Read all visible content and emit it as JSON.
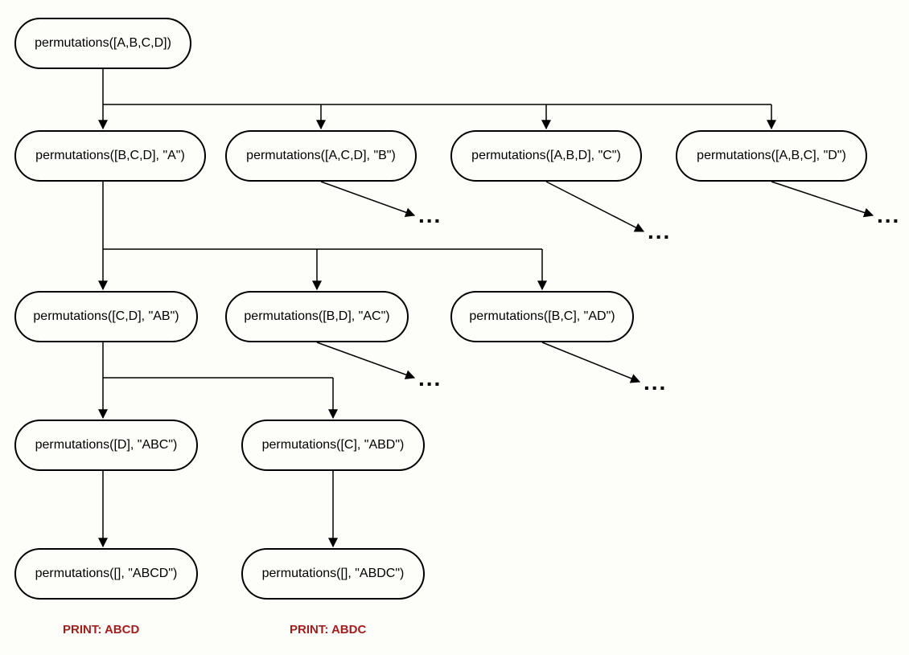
{
  "nodes": {
    "root": "permutations([A,B,C,D])",
    "l1a": "permutations([B,C,D], \"A\")",
    "l1b": "permutations([A,C,D], \"B\")",
    "l1c": "permutations([A,B,D], \"C\")",
    "l1d": "permutations([A,B,C], \"D\")",
    "l2ab": "permutations([C,D], \"AB\")",
    "l2ac": "permutations([B,D], \"AC\")",
    "l2ad": "permutations([B,C], \"AD\")",
    "l3abc": "permutations([D], \"ABC\")",
    "l3abd": "permutations([C], \"ABD\")",
    "l4abcd": "permutations([], \"ABCD\")",
    "l4abdc": "permutations([], \"ABDC\")"
  },
  "leaf_labels": {
    "abcd": "PRINT: ABCD",
    "abdc": "PRINT: ABDC"
  },
  "ellipsis": "..."
}
